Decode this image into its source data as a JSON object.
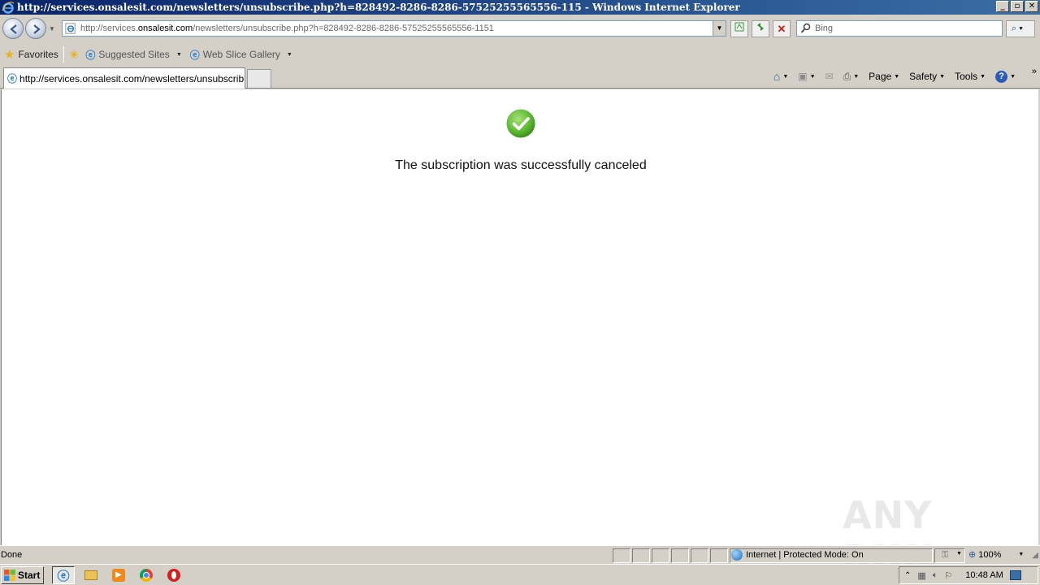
{
  "window": {
    "title": "http://services.onsalesit.com/newsletters/unsubscribe.php?h=828492-8286-8286-57525255565556-115 - Windows Internet Explorer",
    "minimize_label": "_",
    "restore_label": "▫",
    "close_label": "✕"
  },
  "address": {
    "url_prefix": "http://services.",
    "url_domain": "onsalesit.com",
    "url_suffix": "/newsletters/unsubscribe.php?h=828492-8286-8286-57525255565556-1151",
    "search_placeholder": "Bing"
  },
  "favorites_bar": {
    "favorites_label": "Favorites",
    "suggested_sites_label": "Suggested Sites",
    "web_slice_label": "Web Slice Gallery"
  },
  "tabs": [
    {
      "label": "http://services.onsalesit.com/newsletters/unsubscrib..."
    }
  ],
  "command_bar": {
    "page_label": "Page",
    "safety_label": "Safety",
    "tools_label": "Tools",
    "overflow_label": "»"
  },
  "content": {
    "message": "The subscription was successfully canceled",
    "watermark": "ANY RUN"
  },
  "status_bar": {
    "status_text": "Done",
    "zone_text": "Internet | Protected Mode: On",
    "zoom_text": "100%"
  },
  "taskbar": {
    "start_label": "Start",
    "clock": "10:48 AM"
  },
  "colors": {
    "title_bar": "#0a246a",
    "check_green": "#5cb82f",
    "chrome_gray": "#d4d0c8"
  }
}
